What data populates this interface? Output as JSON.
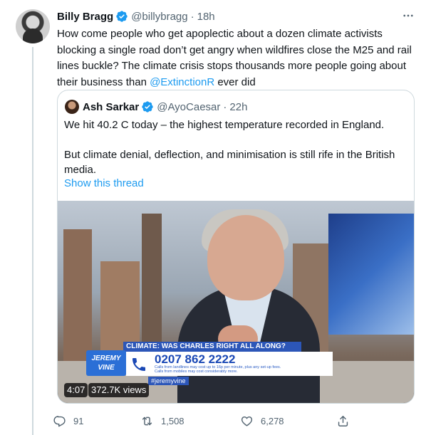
{
  "tweet": {
    "author_name": "Billy Bragg",
    "handle": "@billybragg",
    "separator": "·",
    "time": "18h",
    "text_before": "How come people who get apoplectic about a dozen climate activists blocking a single road don’t get angry when wildfires close the M25 and rail lines buckle? The climate crisis stops thousands more people going about their business than ",
    "mention": "@ExtinctionR",
    "text_after": " ever did",
    "more_icon": "more-horizontal-icon",
    "verified_icon": "verified-badge-icon"
  },
  "quote": {
    "author_name": "Ash Sarkar",
    "handle": "@AyoCaesar",
    "separator": "·",
    "time": "22h",
    "paragraph_1": "We hit 40.2 C today – the highest temperature recorded in England.",
    "paragraph_2": "But climate denial, deflection, and minimisation is still rife in the British media.",
    "show_thread": "Show this thread",
    "video": {
      "duration": "4:07",
      "views": "372.7K views",
      "lower_third": {
        "headline": "CLIMATE: WAS CHARLES RIGHT ALL ALONG?",
        "logo_line1": "JEREMY",
        "logo_line2": "VINE",
        "phone_number": "0207 862 2222",
        "small_print_1": "Calls from landlines may cost up to 16p per minute, plus any set-up fees.",
        "small_print_2": "Calls from mobiles may cost considerably more.",
        "hashtag": "#jeremyvine"
      }
    }
  },
  "actions": {
    "reply_count": "91",
    "retweet_count": "1,508",
    "like_count": "6,278",
    "reply_icon": "reply-icon",
    "retweet_icon": "retweet-icon",
    "like_icon": "heart-icon",
    "share_icon": "share-icon"
  },
  "colors": {
    "link": "#1d9bf0",
    "secondary_text": "#536471",
    "border": "#cfd9de"
  }
}
